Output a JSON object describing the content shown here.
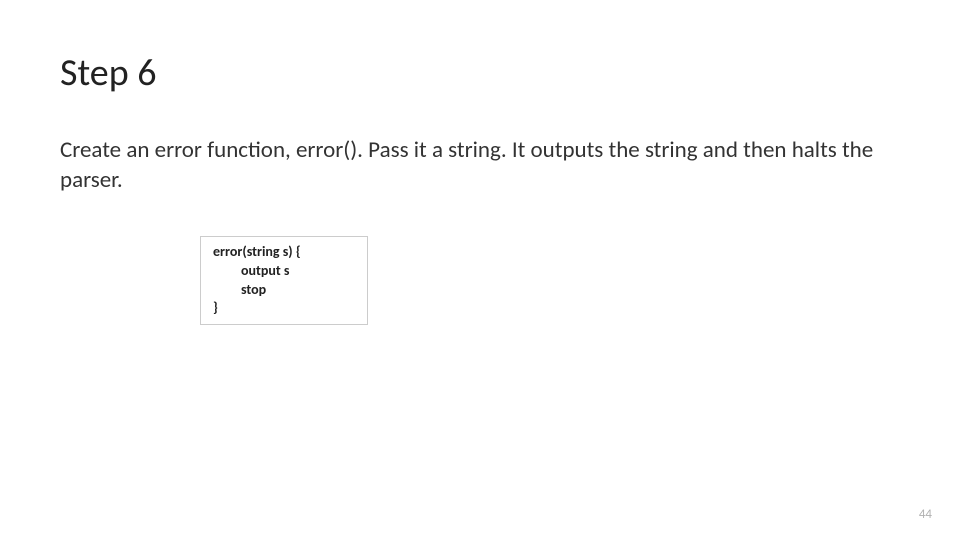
{
  "title": "Step 6",
  "body": "Create an error function, error(). Pass it a string. It outputs the string and then halts the parser.",
  "code": {
    "line1": "error(string s) {",
    "line2": "output s",
    "line3": "stop",
    "line4": "}"
  },
  "page_number": "44"
}
